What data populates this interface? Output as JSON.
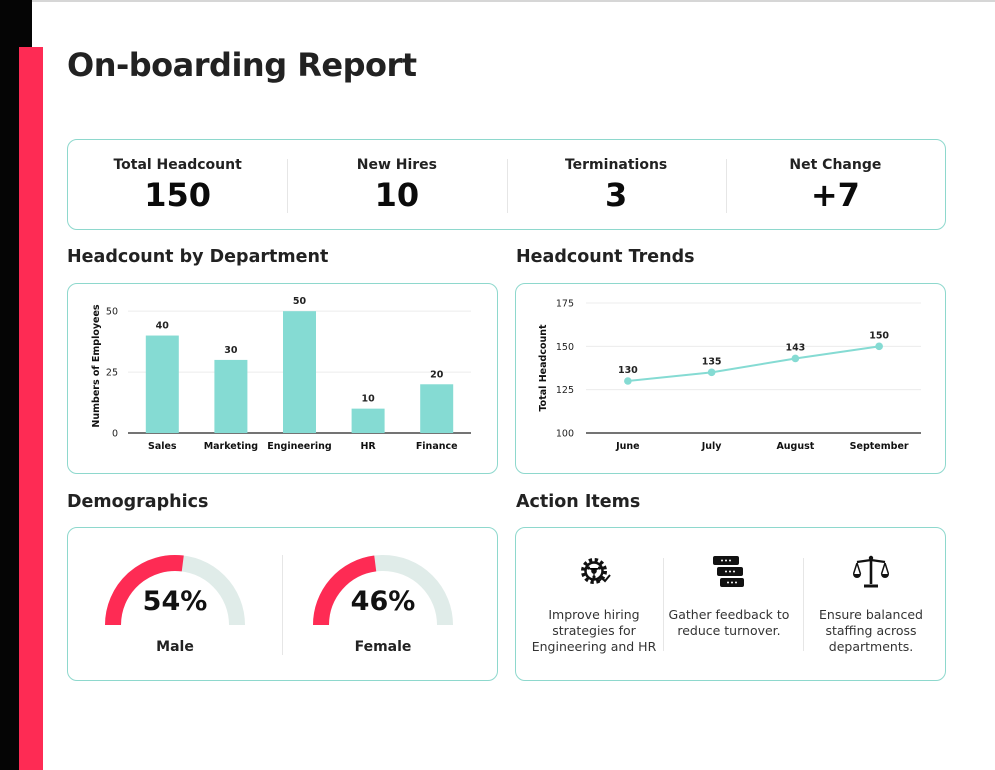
{
  "title": "On-boarding Report",
  "kpis": [
    {
      "label": "Total Headcount",
      "value": "150"
    },
    {
      "label": "New Hires",
      "value": "10"
    },
    {
      "label": "Terminations",
      "value": "3"
    },
    {
      "label": "Net Change",
      "value": "+7"
    }
  ],
  "sections": {
    "department": "Headcount by Department",
    "trends": "Headcount Trends",
    "demographics": "Demographics",
    "actions": "Action Items"
  },
  "colors": {
    "accent": "#fe2b54",
    "teal": "#85dbd3",
    "track": "#e0ece9",
    "border": "#8ed8cd"
  },
  "chart_data": [
    {
      "type": "bar",
      "categories": [
        "Sales",
        "Marketing",
        "Engineering",
        "HR",
        "Finance"
      ],
      "values": [
        40,
        30,
        50,
        10,
        20
      ],
      "ylabel": "Numbers of Employees",
      "yticks": [
        0,
        25,
        50
      ],
      "ylim": [
        0,
        55
      ],
      "grid": true
    },
    {
      "type": "line",
      "categories": [
        "June",
        "July",
        "August",
        "September"
      ],
      "values": [
        130,
        135,
        143,
        150
      ],
      "ylabel": "Total Headcount",
      "yticks": [
        100,
        125,
        150,
        175
      ],
      "ylim": [
        100,
        175
      ],
      "grid": true
    }
  ],
  "demographics": [
    {
      "label": "Male",
      "value": "54%",
      "percent": 54
    },
    {
      "label": "Female",
      "value": "46%",
      "percent": 46
    }
  ],
  "action_items": [
    {
      "icon": "gear-network-icon",
      "text": "Improve hiring strategies for Engineering and HR"
    },
    {
      "icon": "chat-bubbles-icon",
      "text": "Gather feedback to reduce turnover."
    },
    {
      "icon": "balance-scale-icon",
      "text": "Ensure balanced staffing across departments."
    }
  ]
}
